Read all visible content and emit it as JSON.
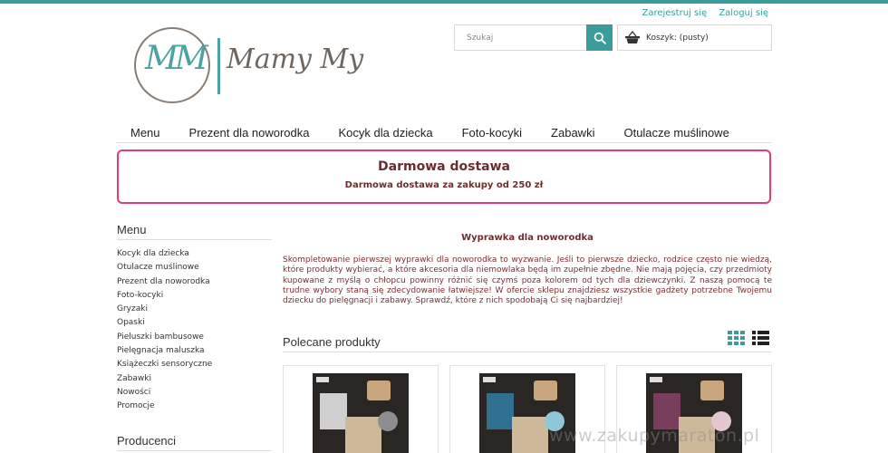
{
  "header": {
    "register_label": "Zarejestruj się",
    "login_label": "Zaloguj się",
    "logo_monogram": "MM",
    "logo_text": "Mamy My",
    "search": {
      "placeholder": "Szukaj"
    },
    "cart_label": "Koszyk: (pusty)"
  },
  "nav": {
    "items": [
      {
        "label": "Menu"
      },
      {
        "label": "Prezent dla noworodka"
      },
      {
        "label": "Kocyk dla dziecka"
      },
      {
        "label": "Foto-kocyki"
      },
      {
        "label": "Zabawki"
      },
      {
        "label": "Otulacze muślinowe"
      }
    ]
  },
  "promo": {
    "title": "Darmowa dostawa",
    "subtitle": "Darmowa dostawa za zakupy od 250 zł"
  },
  "sidebar": {
    "menu_heading": "Menu",
    "items": [
      {
        "label": "Kocyk dla dziecka"
      },
      {
        "label": "Otulacze muślinowe"
      },
      {
        "label": "Prezent dla noworodka"
      },
      {
        "label": "Foto-kocyki"
      },
      {
        "label": "Gryzaki"
      },
      {
        "label": "Opaski"
      },
      {
        "label": "Pieluszki bambusowe"
      },
      {
        "label": "Pielęgnacja maluszka"
      },
      {
        "label": "Książeczki sensoryczne"
      },
      {
        "label": "Zabawki"
      },
      {
        "label": "Nowości"
      },
      {
        "label": "Promocje"
      }
    ],
    "producers_heading": "Producenci"
  },
  "main": {
    "title": "Wyprawka dla noworodka",
    "description": "Skompletowanie pierwszej wyprawki dla noworodka to wyzwanie. Jeśli to pierwsze dziecko, rodzice często nie wiedzą, które produkty wybierać, a które akcesoria dla niemowlaka będą im zupełnie zbędne. Nie mają pojęcia, czy przedmioty kupowane z myślą o chłopcu powinny różnić się czymś poza kolorem od tych dla dziewczynki. Z naszą pomocą te trudne wybory staną się zdecydowanie łatwiejsze! W ofercie sklepu znajdziesz wszystkie gadżety potrzebne Twojemu dziecku do pielęgnacji i zabawy. Sprawdź, które z nich spodobają Ci się najbardziej!"
  },
  "recommended": {
    "heading": "Polecane produkty",
    "products": [
      {
        "muslin_color": "#cfcfcf",
        "bunny_color": "#8d8d92"
      },
      {
        "muslin_color": "#2f6f8f",
        "bunny_color": "#8fc6d8"
      },
      {
        "muslin_color": "#7a3d5e",
        "bunny_color": "#e3c6cf"
      }
    ]
  },
  "watermark": "www.zakupymaraton.pl",
  "colors": {
    "accent": "#3a9d9b",
    "promo_border": "#e63a73",
    "dark_red_text": "#6b2e2e"
  }
}
